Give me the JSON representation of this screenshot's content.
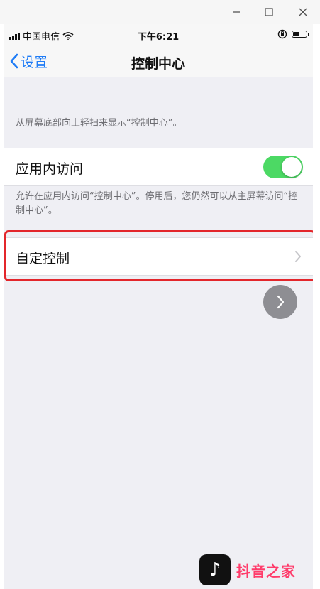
{
  "window_controls": {
    "minimize_icon": "minus-icon",
    "maximize_icon": "square-icon",
    "close_icon": "x-icon"
  },
  "status_bar": {
    "carrier": "中国电信",
    "time": "下午6:21"
  },
  "nav": {
    "back_label": "设置",
    "title": "控制中心"
  },
  "content": {
    "description": "从屏幕底部向上轻扫来显示“控制中心”。",
    "in_app_access": {
      "label": "应用内访问",
      "enabled": true
    },
    "in_app_footer": "允许在应用内访问“控制中心”。停用后，您仍然可以从主屏幕访问“控制中心”。",
    "customize_controls": {
      "label": "自定控制"
    }
  },
  "colors": {
    "accent": "#1f7cf6",
    "toggle_on": "#4cd964",
    "highlight": "#e3262b"
  },
  "watermark": {
    "logo_glyph": "♪",
    "text": "抖音之家"
  }
}
